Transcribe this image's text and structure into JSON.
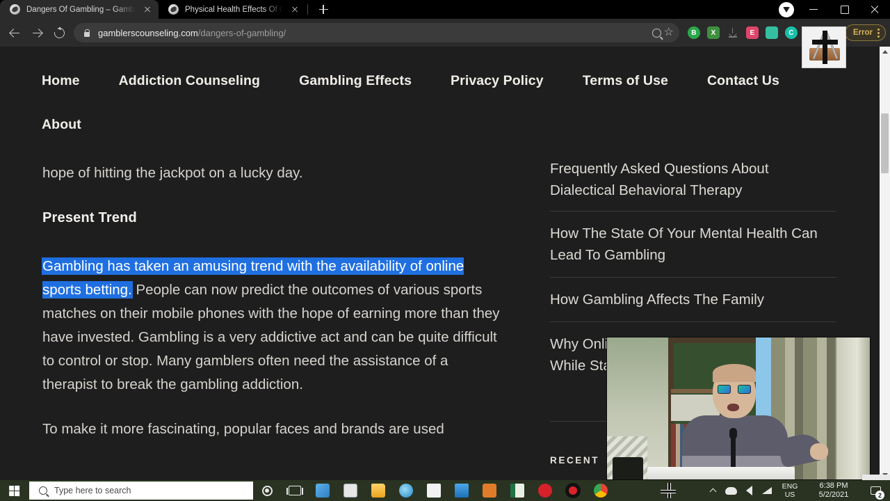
{
  "browser": {
    "tabs": [
      {
        "title": "Dangers Of Gambling – Gambler",
        "favicon": "globe-icon",
        "active": true
      },
      {
        "title": "Physical Health Effects Of Gambl",
        "favicon": "globe-icon",
        "active": false
      }
    ],
    "new_tab_label": "+",
    "window_controls": {
      "minimize": "–",
      "maximize": "□",
      "close": "×"
    },
    "address": {
      "domain": "gamblerscounseling.com",
      "path": "/dangers-of-gambling/"
    },
    "nav": {
      "back": "←",
      "forward": "→",
      "reload": "⟳"
    },
    "omnibox_actions": {
      "zoom": "search-zoom-icon",
      "bookmark": "star-icon"
    },
    "extensions": [
      {
        "name": "bitwarden-extension",
        "glyph": "B",
        "color": "#2aa84a"
      },
      {
        "name": "spreadsheet-extension",
        "glyph": "X",
        "color": "#3f8f3f"
      },
      {
        "name": "download-extension",
        "glyph": "",
        "color": "#5a5a5a"
      },
      {
        "name": "adblock-extension",
        "glyph": "E",
        "color": "#e0456b"
      },
      {
        "name": "screenshot-extension",
        "glyph": "",
        "color": "#34c0a0"
      },
      {
        "name": "circle-extension",
        "glyph": "C",
        "color": "#18bfa8"
      },
      {
        "name": "grammar-extension",
        "glyph": "",
        "color": "#3cc040"
      },
      {
        "name": "pink-arrow-extension",
        "glyph": "",
        "color": "#f08aa0"
      }
    ],
    "error_badge": {
      "label": "Error",
      "menu": "kebab-menu-icon"
    },
    "profile": "profile-avatar"
  },
  "site": {
    "nav_row1": [
      "Home",
      "Addiction Counseling",
      "Gambling Effects",
      "Privacy Policy",
      "Terms of Use",
      "Contact Us"
    ],
    "nav_row2": [
      "About"
    ],
    "article": {
      "cut_line": "hope of hitting the jackpot on a lucky day.",
      "heading": "Present Trend",
      "para_selected": "Gambling has taken an amusing trend with the availability of online sports betting.",
      "para_rest": " People can now predict the outcomes of various sports matches on their mobile phones with the hope of earning more than they have invested. Gambling is a very addictive act and can be quite difficult to control or stop. Many gamblers often need the assistance of a therapist to break the gambling addiction.",
      "para_next": "To make it more fascinating, popular faces and brands are used"
    },
    "sidebar": {
      "items": [
        "Frequently Asked Questions About Dialectical Behavioral Therapy",
        "How The State Of Your Mental Health Can Lead To Gambling",
        "How Gambling Affects The Family",
        "Why Online Gambling Is Forbidden Even While Sta"
      ],
      "heading": "RECENT"
    }
  },
  "taskbar": {
    "start": "windows-logo-icon",
    "search_placeholder": "Type here to search",
    "cortana": "cortana-circle-icon",
    "taskview": "task-view-icon",
    "pinned": [
      {
        "name": "paint-3d-app",
        "color": "#2f7ec4"
      },
      {
        "name": "news-app",
        "color": "#dedede"
      },
      {
        "name": "file-explorer-app",
        "color": "#f0b429"
      },
      {
        "name": "internet-explorer-app",
        "color": "#2b9ad6"
      },
      {
        "name": "microsoft-store-app",
        "color": "#e8e8e8"
      },
      {
        "name": "mail-app",
        "color": "#2e8bd4"
      },
      {
        "name": "media-player-app",
        "color": "#e07b2a"
      },
      {
        "name": "excel-app",
        "color": "#1f7244"
      },
      {
        "name": "opera-app",
        "color": "#d6202a"
      },
      {
        "name": "screen-recorder-app",
        "color": "#d8232a"
      },
      {
        "name": "google-chrome-app",
        "color": "#4285f4"
      }
    ],
    "tray": {
      "overflow": "chevron-up-icon",
      "onedrive": "onedrive-cloud-icon",
      "volume": "speaker-icon",
      "network": "wifi-icon",
      "language_top": "ENG",
      "language_bottom": "US",
      "time": "6:38 PM",
      "date": "5/2/2021",
      "notification_count": "2"
    }
  },
  "overlays": {
    "webcam": "webcam-presenter-video",
    "extension_thumbnail": "cross-swords-book-image",
    "cursor": "crosshair-cursor"
  }
}
